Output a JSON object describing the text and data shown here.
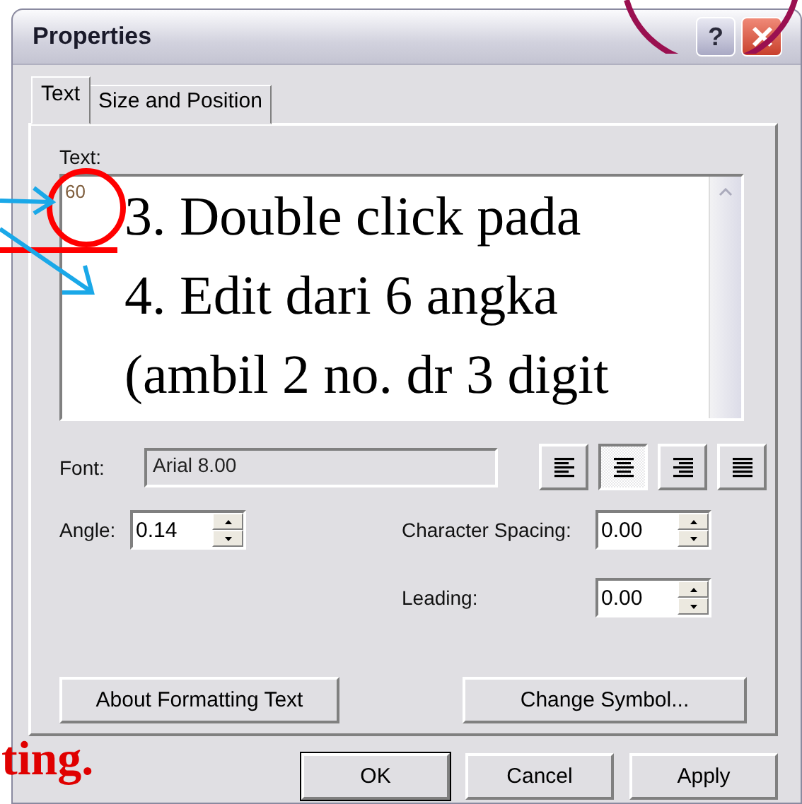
{
  "window": {
    "title": "Properties",
    "help": "?"
  },
  "tabs": [
    {
      "label": "Text",
      "selected": true
    },
    {
      "label": "Size and Position",
      "selected": false
    }
  ],
  "text_field": {
    "label": "Text:",
    "value": "60"
  },
  "font": {
    "label": "Font:",
    "value": "Arial 8.00"
  },
  "alignment": [
    {
      "kind": "left",
      "selected": false
    },
    {
      "kind": "center",
      "selected": true
    },
    {
      "kind": "right",
      "selected": false
    },
    {
      "kind": "justify",
      "selected": false
    }
  ],
  "spinners": [
    {
      "kind": "angle",
      "label": "Angle:",
      "value": "0.14"
    },
    {
      "kind": "character_spacing",
      "label": "Character Spacing:",
      "value": "0.00"
    },
    {
      "kind": "leading",
      "label": "Leading:",
      "value": "0.00"
    }
  ],
  "buttons": [
    "About Formatting Text",
    "Change Symbol..."
  ],
  "dialog_buttons": [
    {
      "label": "OK",
      "default": true
    },
    {
      "label": "Cancel",
      "default": false
    },
    {
      "label": "Apply",
      "default": false
    }
  ],
  "annotations": {
    "lines": [
      "3. Double click pada",
      "4. Edit dari 6 angka",
      "(ambil 2 no. dr 3 digit"
    ],
    "footer": "ting."
  }
}
